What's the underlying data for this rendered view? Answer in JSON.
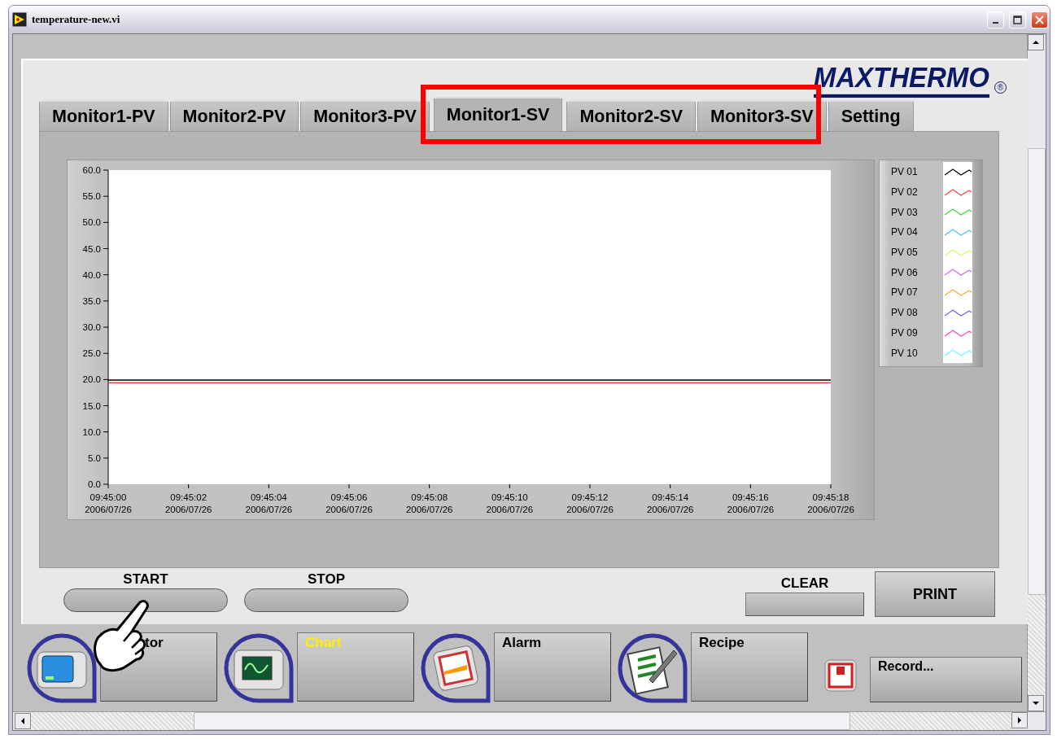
{
  "window": {
    "title": "temperature-new.vi"
  },
  "logo": {
    "text": "MAXTHERMO",
    "mark": "®"
  },
  "tabs": [
    {
      "label": "Monitor1-PV",
      "selected": false
    },
    {
      "label": "Monitor2-PV",
      "selected": false
    },
    {
      "label": "Monitor3-PV",
      "selected": false
    },
    {
      "label": "Monitor1-SV",
      "selected": true
    },
    {
      "label": "Monitor2-SV",
      "selected": false
    },
    {
      "label": "Monitor3-SV",
      "selected": false
    },
    {
      "label": "Setting",
      "selected": false
    }
  ],
  "chart": {
    "chart_data": {
      "type": "line",
      "ylim": [
        0,
        60
      ],
      "categories": [
        "09:45:00\n2006/07/26",
        "09:45:02\n2006/07/26",
        "09:45:04\n2006/07/26",
        "09:45:06\n2006/07/26",
        "09:45:08\n2006/07/26",
        "09:45:10\n2006/07/26",
        "09:45:12\n2006/07/26",
        "09:45:14\n2006/07/26",
        "09:45:16\n2006/07/26",
        "09:45:18\n2006/07/26"
      ],
      "yticks": [
        {
          "value": 0,
          "label": "0.0"
        },
        {
          "value": 5,
          "label": "5.0"
        },
        {
          "value": 10,
          "label": "10.0"
        },
        {
          "value": 15,
          "label": "15.0"
        },
        {
          "value": 20,
          "label": "20.0"
        },
        {
          "value": 25,
          "label": "25.0"
        },
        {
          "value": 30,
          "label": "30.0"
        },
        {
          "value": 35,
          "label": "35.0"
        },
        {
          "value": 40,
          "label": "40.0"
        },
        {
          "value": 45,
          "label": "45.0"
        },
        {
          "value": 50,
          "label": "50.0"
        },
        {
          "value": 55,
          "label": "55.0"
        },
        {
          "value": 60,
          "label": "60.0"
        }
      ],
      "series": [
        {
          "name": "PV 01",
          "color": "#000000",
          "values": [
            19.9,
            19.9,
            19.9,
            19.9,
            19.9,
            19.9,
            19.9,
            19.9,
            19.9,
            19.9
          ]
        },
        {
          "name": "PV 02",
          "color": "#ff4040",
          "values": [
            19.4,
            19.4,
            19.4,
            19.4,
            19.4,
            19.4,
            19.4,
            19.4,
            19.4,
            19.4
          ]
        },
        {
          "name": "PV 03",
          "color": "#33dd33",
          "values": [
            null,
            null,
            null,
            null,
            null,
            null,
            null,
            null,
            null,
            null
          ]
        },
        {
          "name": "PV 04",
          "color": "#55bbff",
          "values": [
            null,
            null,
            null,
            null,
            null,
            null,
            null,
            null,
            null,
            null
          ]
        },
        {
          "name": "PV 05",
          "color": "#ccff66",
          "values": [
            null,
            null,
            null,
            null,
            null,
            null,
            null,
            null,
            null,
            null
          ]
        },
        {
          "name": "PV 06",
          "color": "#cc66ff",
          "values": [
            null,
            null,
            null,
            null,
            null,
            null,
            null,
            null,
            null,
            null
          ]
        },
        {
          "name": "PV 07",
          "color": "#ffaa33",
          "values": [
            null,
            null,
            null,
            null,
            null,
            null,
            null,
            null,
            null,
            null
          ]
        },
        {
          "name": "PV 08",
          "color": "#6666ff",
          "values": [
            null,
            null,
            null,
            null,
            null,
            null,
            null,
            null,
            null,
            null
          ]
        },
        {
          "name": "PV 09",
          "color": "#ff44aa",
          "values": [
            null,
            null,
            null,
            null,
            null,
            null,
            null,
            null,
            null,
            null
          ]
        },
        {
          "name": "PV 10",
          "color": "#66ffff",
          "values": [
            null,
            null,
            null,
            null,
            null,
            null,
            null,
            null,
            null,
            null
          ]
        }
      ]
    }
  },
  "controls": [
    {
      "kind": "pill",
      "label": "START"
    },
    {
      "kind": "pill",
      "label": "STOP"
    },
    {
      "kind": "captioned",
      "label": "CLEAR"
    },
    {
      "kind": "button",
      "label": "PRINT"
    }
  ],
  "toolbar": [
    {
      "kind": "big",
      "label": "tor",
      "active": false
    },
    {
      "kind": "big",
      "label": "Chart",
      "active": true
    },
    {
      "kind": "big",
      "label": "Alarm",
      "active": false
    },
    {
      "kind": "big",
      "label": "Recipe",
      "active": false
    },
    {
      "kind": "small",
      "label": "Record...",
      "active": false
    }
  ]
}
